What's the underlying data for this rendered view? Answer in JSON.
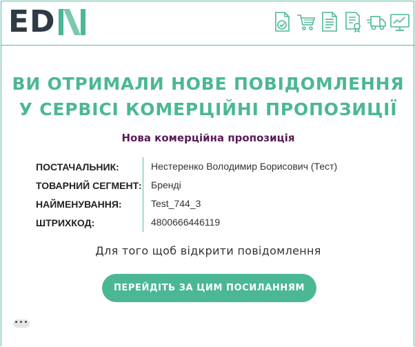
{
  "header": {
    "logo": {
      "letters_dark": "ED",
      "letters_light": "N"
    },
    "icons": [
      "document-check-icon",
      "shopping-cart-icon",
      "document-lines-icon",
      "certificate-document-icon",
      "delivery-truck-icon",
      "monitor-chart-icon"
    ]
  },
  "message": {
    "headline_line1": "ВИ ОТРИМАЛИ НОВЕ ПОВІДОМЛЕННЯ",
    "headline_line2": "У СЕРВІСІ КОМЕРЦІЙНІ ПРОПОЗИЦІЇ",
    "subtitle": "Нова комерційна пропозиція"
  },
  "details": [
    {
      "label": "ПОСТАЧАЛЬНИК:",
      "value": "Нестеренко Володимир Борисович (Тест)"
    },
    {
      "label": "ТОВАРНИЙ СЕГМЕНТ:",
      "value": "Бренді"
    },
    {
      "label": "НАЙМЕНУВАННЯ:",
      "value": "Test_744_3"
    },
    {
      "label": "ШТРИХКОД:",
      "value": "4800666446119"
    }
  ],
  "cta": {
    "text": "Для того щоб відкрити повідомлення",
    "button_label": "ПЕРЕЙДІТЬ ЗА ЦИМ ПОСИЛАННЯМ"
  },
  "footer": {
    "more_label": "•••"
  },
  "colors": {
    "accent": "#4bb795",
    "border": "#58b7a0",
    "subtitle": "#5a1b57",
    "logo_dark": "#2f3a45"
  }
}
